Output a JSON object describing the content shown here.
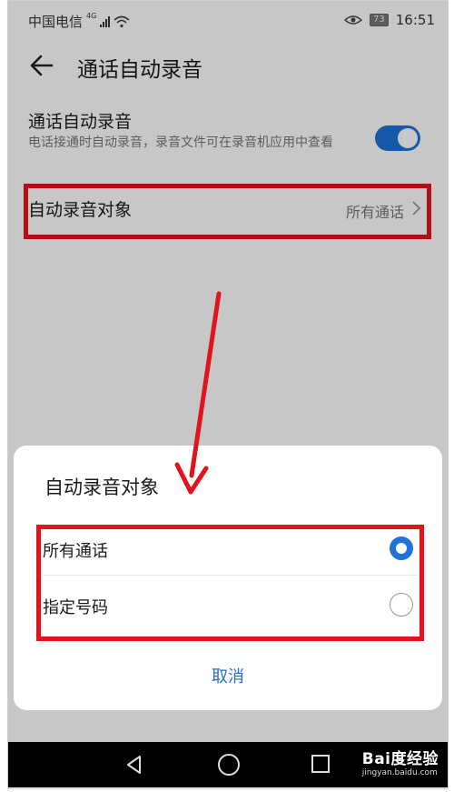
{
  "status_bar": {
    "carrier": "中国电信",
    "network": "4G",
    "battery": "73",
    "time": "16:51"
  },
  "header": {
    "title": "通话自动录音",
    "back_icon": "arrow-left-icon"
  },
  "settings": {
    "auto_record": {
      "label": "通话自动录音",
      "description": "电话接通时自动录音，录音文件可在录音机应用中查看",
      "enabled": true
    },
    "record_target": {
      "label": "自动录音对象",
      "value": "所有通话"
    }
  },
  "dialog": {
    "title": "自动录音对象",
    "options": [
      {
        "label": "所有通话",
        "selected": true
      },
      {
        "label": "指定号码",
        "selected": false
      }
    ],
    "cancel_label": "取消"
  },
  "watermark": {
    "brand": "Bai度经验",
    "url": "jingyan.baidu.com"
  },
  "colors": {
    "accent": "#1e73d8",
    "highlight": "#e0141c"
  }
}
